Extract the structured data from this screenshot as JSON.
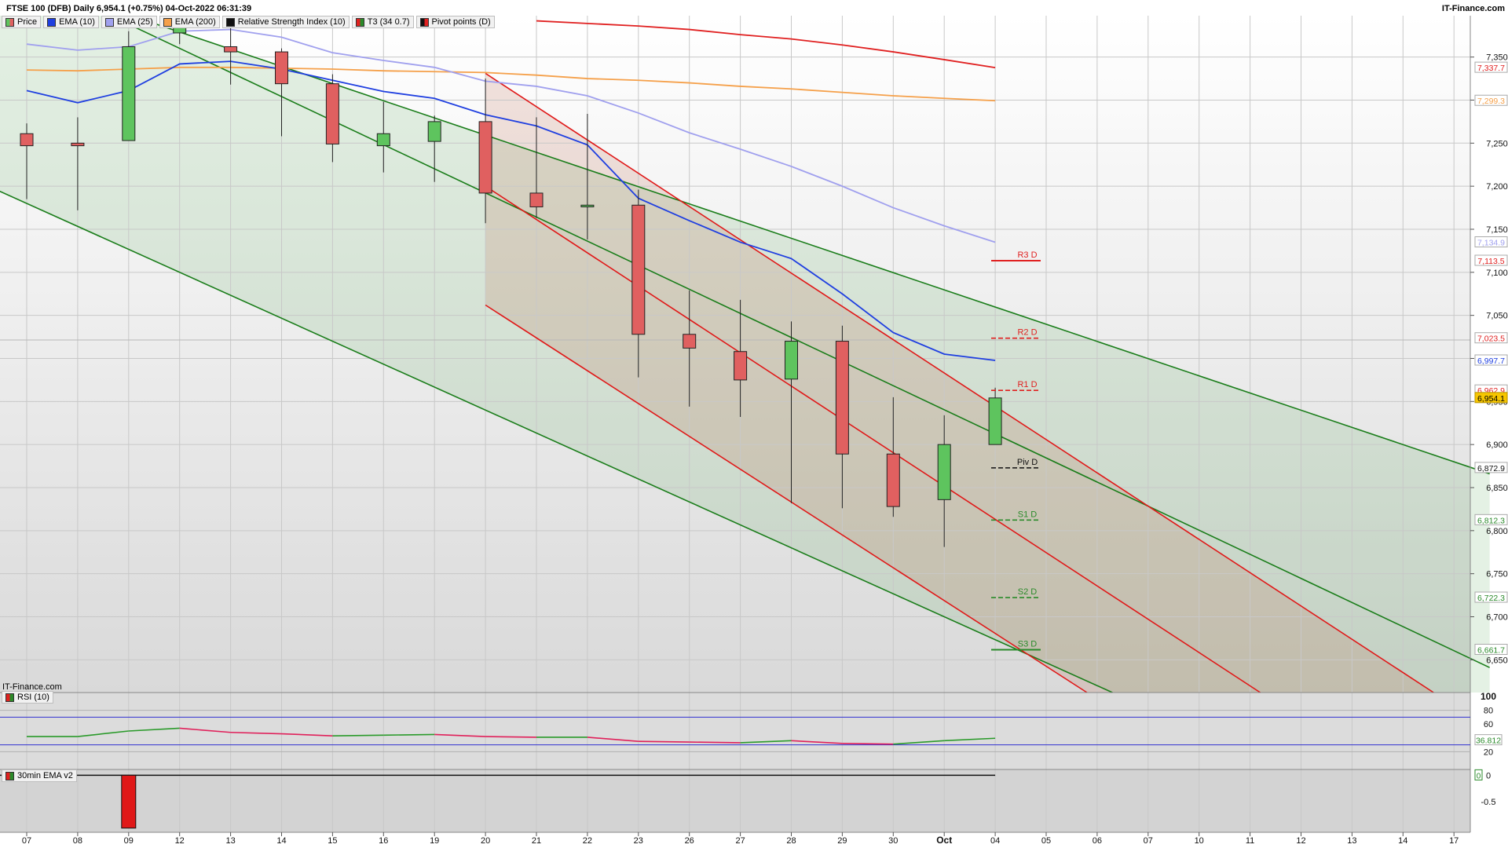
{
  "header": {
    "title": "FTSE 100 (DFB) Daily 6,954.1 (+0.75%) 04-Oct-2022 06:31:39",
    "brand": "IT-Finance.com",
    "watermark": "IT-Finance.com"
  },
  "legend": [
    {
      "label": "Price",
      "color": "#5ec45e",
      "color2": "#e06060"
    },
    {
      "label": "EMA (10)",
      "color": "#1f3fe0"
    },
    {
      "label": "EMA (25)",
      "color": "#a0a0ee"
    },
    {
      "label": "EMA (200)",
      "color": "#f5a04a"
    },
    {
      "label": "Relative Strength Index (10)",
      "color": "#111111"
    },
    {
      "label": "T3 (34 0.7)",
      "color": "#e02020",
      "color2": "#2a8a2a"
    },
    {
      "label": "Pivot points (D)",
      "color": "#111111",
      "color2": "#e02020"
    }
  ],
  "panes": {
    "rsi_label": "RSI (10)",
    "ema30_label": "30min EMA v2"
  },
  "chart_data": {
    "type": "candlestick",
    "x_labels": [
      "07",
      "08",
      "09",
      "12",
      "13",
      "14",
      "15",
      "16",
      "19",
      "20",
      "21",
      "22",
      "23",
      "26",
      "27",
      "28",
      "29",
      "30",
      "Oct",
      "04",
      "05",
      "06",
      "07",
      "10",
      "11",
      "12",
      "13",
      "14",
      "17"
    ],
    "candles": [
      {
        "x": "07",
        "open": 7261,
        "high": 7273,
        "low": 7185,
        "close": 7247
      },
      {
        "x": "08",
        "open": 7250,
        "high": 7280,
        "low": 7172,
        "close": 7247
      },
      {
        "x": "09",
        "open": 7253,
        "high": 7380,
        "low": 7253,
        "close": 7362
      },
      {
        "x": "12",
        "open": 7378,
        "high": 7398,
        "low": 7365,
        "close": 7388
      },
      {
        "x": "13",
        "open": 7362,
        "high": 7395,
        "low": 7318,
        "close": 7356
      },
      {
        "x": "14",
        "open": 7356,
        "high": 7360,
        "low": 7258,
        "close": 7319
      },
      {
        "x": "15",
        "open": 7319,
        "high": 7330,
        "low": 7228,
        "close": 7249
      },
      {
        "x": "16",
        "open": 7247,
        "high": 7298,
        "low": 7216,
        "close": 7261
      },
      {
        "x": "19",
        "open": 7252,
        "high": 7282,
        "low": 7205,
        "close": 7275
      },
      {
        "x": "20",
        "open": 7275,
        "high": 7325,
        "low": 7157,
        "close": 7192
      },
      {
        "x": "21",
        "open": 7192,
        "high": 7280,
        "low": 7163,
        "close": 7176
      },
      {
        "x": "22",
        "open": 7176,
        "high": 7284,
        "low": 7138,
        "close": 7178
      },
      {
        "x": "23",
        "open": 7178,
        "high": 7196,
        "low": 6978,
        "close": 7028
      },
      {
        "x": "26",
        "open": 7028,
        "high": 7079,
        "low": 6944,
        "close": 7012
      },
      {
        "x": "27",
        "open": 7008,
        "high": 7068,
        "low": 6932,
        "close": 6975
      },
      {
        "x": "28",
        "open": 6976,
        "high": 7043,
        "low": 6832,
        "close": 7020
      },
      {
        "x": "29",
        "open": 7020,
        "high": 7038,
        "low": 6826,
        "close": 6889
      },
      {
        "x": "30",
        "open": 6889,
        "high": 6955,
        "low": 6816,
        "close": 6828
      },
      {
        "x": "Oct",
        "open": 6836,
        "high": 6934,
        "low": 6781,
        "close": 6900
      },
      {
        "x": "04",
        "open": 6900,
        "high": 6966,
        "low": 6900,
        "close": 6954.1
      }
    ],
    "ema10": [
      7311,
      7297,
      7311,
      7342,
      7345,
      7336,
      7323,
      7310,
      7302,
      7283,
      7270,
      7248,
      7186,
      7160,
      7135,
      7116,
      7075,
      7030,
      7005,
      6997.7
    ],
    "ema25": [
      7365,
      7358,
      7362,
      7380,
      7382,
      7373,
      7355,
      7346,
      7338,
      7322,
      7316,
      7305,
      7285,
      7262,
      7243,
      7223,
      7200,
      7175,
      7154,
      7134.9
    ],
    "ema200": [
      7335,
      7334,
      7336,
      7338,
      7338,
      7337,
      7336,
      7334,
      7333,
      7332,
      7329,
      7325,
      7323,
      7320,
      7316,
      7313,
      7309,
      7305,
      7302,
      7299.3
    ],
    "t3": [
      7392,
      7389,
      7386,
      7382,
      7376,
      7371,
      7364,
      7356,
      7347,
      7337.7
    ],
    "pivots": [
      {
        "label": "R3 D",
        "value": 7113.5,
        "color": "#e02020"
      },
      {
        "label": "R2 D",
        "value": 7023.5,
        "color": "#e02020"
      },
      {
        "label": "R1 D",
        "value": 6962.9,
        "color": "#e02020"
      },
      {
        "label": "Piv D",
        "value": 6872.9,
        "color": "#111111"
      },
      {
        "label": "S1 D",
        "value": 6812.3,
        "color": "#2a8a2a"
      },
      {
        "label": "S2 D",
        "value": 6722.3,
        "color": "#2a8a2a"
      },
      {
        "label": "S3 D",
        "value": 6661.7,
        "color": "#2a8a2a"
      }
    ],
    "price_ticks": [
      "7,350",
      "7,300",
      "7,250",
      "7,200",
      "7,150",
      "7,100",
      "7,050",
      "7,000",
      "6,950",
      "6,900",
      "6,850",
      "6,800",
      "6,750",
      "6,700",
      "6,650"
    ],
    "price_labels": [
      {
        "text": "7,337.7",
        "value": 7337.7,
        "color": "#e02020"
      },
      {
        "text": "7,299.3",
        "value": 7299.3,
        "color": "#f5a04a"
      },
      {
        "text": "7,134.9",
        "value": 7134.9,
        "color": "#a0a0ee"
      },
      {
        "text": "7,113.5",
        "value": 7113.5,
        "color": "#e02020"
      },
      {
        "text": "7,023.5",
        "value": 7023.5,
        "color": "#e02020"
      },
      {
        "text": "6,997.7",
        "value": 6997.7,
        "color": "#1f3fe0"
      },
      {
        "text": "6,962.9",
        "value": 6962.9,
        "color": "#e02020"
      },
      {
        "text": "6,954.1",
        "value": 6954.1,
        "color": "#f7c600"
      },
      {
        "text": "6,872.9",
        "value": 6872.9,
        "color": "#111111"
      },
      {
        "text": "6,812.3",
        "value": 6812.3,
        "color": "#2a8a2a"
      },
      {
        "text": "6,722.3",
        "value": 6722.3,
        "color": "#2a8a2a"
      },
      {
        "text": "6,661.7",
        "value": 6661.7,
        "color": "#2a8a2a"
      }
    ],
    "ylim": [
      6612,
      7398
    ],
    "rsi": {
      "values": [
        42,
        42,
        50,
        54,
        48,
        46,
        43,
        44,
        45,
        42,
        41,
        41,
        35,
        34,
        33,
        36,
        32,
        31,
        36,
        39.5
      ],
      "ticks": [
        "100",
        "80",
        "60",
        "20"
      ],
      "last": "36.812",
      "ylim": [
        0,
        100
      ],
      "levels": [
        70,
        30
      ]
    },
    "ema30": {
      "bar_value": -1.0,
      "bar_x": "09",
      "ticks": [
        "0",
        "-0.5"
      ],
      "last": "0",
      "ylim": [
        -1.05,
        0.08
      ]
    },
    "channels": {
      "green_upper": [
        [
          0,
          7439
        ],
        [
          28.7,
          6866
        ]
      ],
      "green_lower": [
        [
          0,
          7180
        ],
        [
          21.3,
          6612
        ]
      ],
      "green_mid": [
        [
          0,
          7444
        ],
        [
          28.7,
          6641
        ]
      ],
      "red_upper": [
        [
          9,
          7331
        ],
        [
          27.6,
          6612
        ]
      ],
      "red_lower": [
        [
          9,
          7062
        ],
        [
          20.8,
          6612
        ]
      ],
      "red_mid": [
        [
          9,
          7200
        ],
        [
          24.2,
          6612
        ]
      ]
    },
    "grid": true
  }
}
